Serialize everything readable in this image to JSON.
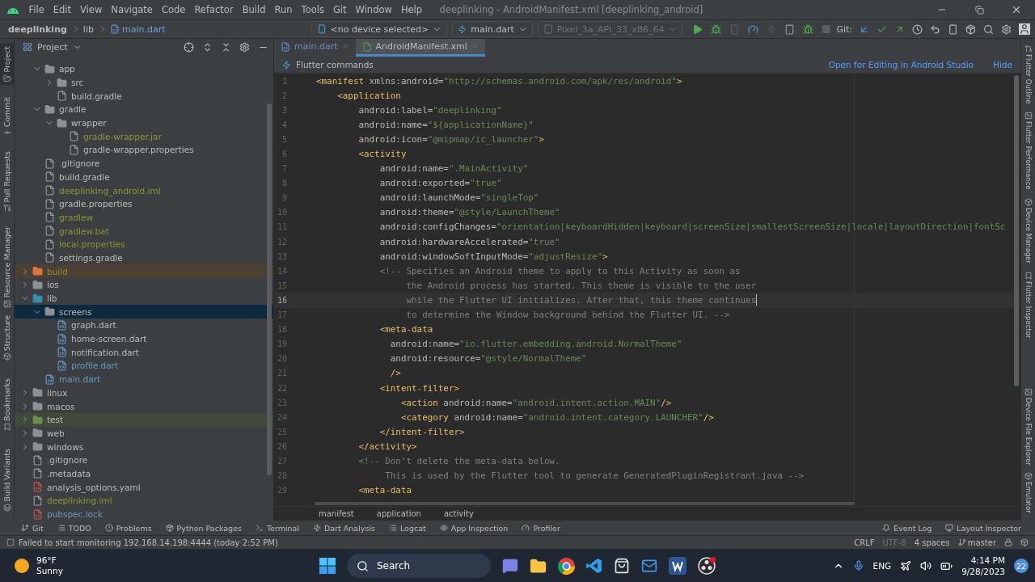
{
  "title_bar": {
    "menus": [
      "File",
      "Edit",
      "View",
      "Navigate",
      "Code",
      "Refactor",
      "Build",
      "Run",
      "Tools",
      "Git",
      "Window",
      "Help"
    ],
    "title": "deeplinking - AndroidManifest.xml [deeplinking_android]"
  },
  "nav_bar": {
    "breadcrumbs": [
      "deeplinking",
      "lib",
      "main.dart"
    ],
    "device": "<no device selected>",
    "run_config": "main.dart",
    "emulator": "Pixel_3a_API_33_x86_64",
    "git_label": "Git:"
  },
  "left_tool_strip": {
    "top": [
      {
        "label": "Project",
        "selected": true
      },
      {
        "label": "Commit",
        "selected": false
      },
      {
        "label": "Pull Requests",
        "selected": false
      },
      {
        "label": "Resource Manager",
        "selected": false
      }
    ],
    "bottom": [
      {
        "label": "Structure",
        "selected": false
      },
      {
        "label": "Bookmarks",
        "selected": false
      },
      {
        "label": "Build Variants",
        "selected": false
      }
    ]
  },
  "project_panel": {
    "title": "Project",
    "tree": [
      {
        "kind": "offscreen",
        "children": [
          {
            "label": "app",
            "kind": "folder",
            "ignored": false,
            "modified": false,
            "selected": false,
            "expanded": true,
            "children": [
              {
                "label": "src",
                "kind": "folder",
                "ignored": false,
                "modified": false,
                "selected": false,
                "expanded": false
              },
              {
                "label": "build.gradle",
                "kind": "file",
                "ignored": false,
                "modified": false,
                "selected": false
              }
            ]
          },
          {
            "label": "gradle",
            "kind": "folder",
            "ignored": false,
            "modified": false,
            "selected": false,
            "expanded": true,
            "children": [
              {
                "label": "wrapper",
                "kind": "folder",
                "ignored": false,
                "modified": false,
                "selected": false,
                "expanded": true,
                "children": [
                  {
                    "label": "gradle-wrapper.jar",
                    "kind": "file",
                    "ignored": true,
                    "modified": false,
                    "selected": false
                  },
                  {
                    "label": "gradle-wrapper.properties",
                    "kind": "file",
                    "ignored": false,
                    "modified": false,
                    "selected": false
                  }
                ]
              }
            ]
          },
          {
            "label": ".gitignore",
            "kind": "file",
            "ignored": false,
            "modified": false,
            "selected": false
          },
          {
            "label": "build.gradle",
            "kind": "file",
            "ignored": false,
            "modified": false,
            "selected": false
          },
          {
            "label": "deeplinking_android.iml",
            "kind": "file",
            "ignored": true,
            "modified": false,
            "selected": false
          },
          {
            "label": "gradle.properties",
            "kind": "file",
            "ignored": false,
            "modified": false,
            "selected": false
          },
          {
            "label": "gradlew",
            "kind": "file",
            "ignored": true,
            "modified": false,
            "selected": false
          },
          {
            "label": "gradlew.bat",
            "kind": "file",
            "ignored": true,
            "modified": false,
            "selected": false
          },
          {
            "label": "local.properties",
            "kind": "file",
            "ignored": true,
            "modified": false,
            "selected": false
          },
          {
            "label": "settings.gradle",
            "kind": "file",
            "ignored": false,
            "modified": false,
            "selected": false
          }
        ]
      },
      {
        "label": "build",
        "kind": "excluded-folder",
        "ignored": true,
        "modified": false,
        "selected": false,
        "expanded": false
      },
      {
        "label": "ios",
        "kind": "folder",
        "ignored": false,
        "modified": false,
        "selected": false,
        "expanded": false
      },
      {
        "label": "lib",
        "kind": "source-folder",
        "ignored": false,
        "modified": false,
        "selected": false,
        "expanded": true,
        "children": [
          {
            "label": "screens",
            "kind": "folder",
            "ignored": false,
            "modified": false,
            "selected": true,
            "expanded": true,
            "children": [
              {
                "label": "graph.dart",
                "kind": "dart-file",
                "ignored": false,
                "modified": false,
                "selected": false
              },
              {
                "label": "home-screen.dart",
                "kind": "dart-file",
                "ignored": false,
                "modified": false,
                "selected": false
              },
              {
                "label": "notification.dart",
                "kind": "dart-file",
                "ignored": false,
                "modified": false,
                "selected": false
              },
              {
                "label": "profile.dart",
                "kind": "dart-file",
                "ignored": false,
                "modified": true,
                "selected": false
              }
            ]
          },
          {
            "label": "main.dart",
            "kind": "dart-file",
            "ignored": false,
            "modified": true,
            "selected": false
          }
        ]
      },
      {
        "label": "linux",
        "kind": "folder",
        "ignored": false,
        "modified": false,
        "selected": false,
        "expanded": false
      },
      {
        "label": "macos",
        "kind": "folder",
        "ignored": false,
        "modified": false,
        "selected": false,
        "expanded": false
      },
      {
        "label": "test",
        "kind": "test-folder",
        "ignored": false,
        "modified": false,
        "selected": false,
        "expanded": false
      },
      {
        "label": "web",
        "kind": "folder",
        "ignored": false,
        "modified": false,
        "selected": false,
        "expanded": false
      },
      {
        "label": "windows",
        "kind": "folder",
        "ignored": false,
        "modified": false,
        "selected": false,
        "expanded": false
      },
      {
        "label": ".gitignore",
        "kind": "file",
        "ignored": false,
        "modified": false,
        "selected": false
      },
      {
        "label": ".metadata",
        "kind": "file",
        "ignored": false,
        "modified": false,
        "selected": false
      },
      {
        "label": "analysis_options.yaml",
        "kind": "yaml-file",
        "ignored": false,
        "modified": false,
        "selected": false
      },
      {
        "label": "deeplinking.iml",
        "kind": "file",
        "ignored": true,
        "modified": false,
        "selected": false
      },
      {
        "label": "pubspec.lock",
        "kind": "yaml-file",
        "ignored": false,
        "modified": true,
        "selected": false
      }
    ]
  },
  "editor": {
    "tabs": [
      {
        "label": "main.dart",
        "kind": "dart",
        "selected": false
      },
      {
        "label": "AndroidManifest.xml",
        "kind": "xml",
        "selected": true
      }
    ],
    "banner": {
      "title": "Flutter commands",
      "action": "Open for Editing in Android Studio",
      "dismiss": "Hide"
    },
    "lines": [
      {
        "n": "1",
        "current": false,
        "tokens": [
          {
            "kind": "tag",
            "text": "<manifest"
          },
          {
            "kind": "attr",
            "text": " xmlns:android="
          },
          {
            "kind": "value",
            "text": "\"http://schemas.android.com/apk/res/android\""
          },
          {
            "kind": "tag",
            "text": ">"
          }
        ]
      },
      {
        "n": "2",
        "current": false,
        "tokens": [
          {
            "kind": "tag",
            "text": "    <application"
          }
        ]
      },
      {
        "n": "3",
        "current": false,
        "tokens": [
          {
            "kind": "attr",
            "text": "        android:label="
          },
          {
            "kind": "value",
            "text": "\"deeplinking\""
          }
        ]
      },
      {
        "n": "4",
        "current": false,
        "tokens": [
          {
            "kind": "attr",
            "text": "        android:name="
          },
          {
            "kind": "value",
            "text": "\"${applicationName}\""
          }
        ]
      },
      {
        "n": "5",
        "current": false,
        "tokens": [
          {
            "kind": "attr",
            "text": "        android:icon="
          },
          {
            "kind": "value",
            "text": "\"@mipmap/ic_launcher\""
          },
          {
            "kind": "tag",
            "text": ">"
          }
        ]
      },
      {
        "n": "6",
        "current": false,
        "tokens": [
          {
            "kind": "tag",
            "text": "        <activity"
          }
        ]
      },
      {
        "n": "7",
        "current": false,
        "tokens": [
          {
            "kind": "attr",
            "text": "            android:name="
          },
          {
            "kind": "value",
            "text": "\".MainActivity\""
          }
        ]
      },
      {
        "n": "8",
        "current": false,
        "tokens": [
          {
            "kind": "attr",
            "text": "            android:exported="
          },
          {
            "kind": "value",
            "text": "\"true\""
          }
        ]
      },
      {
        "n": "9",
        "current": false,
        "tokens": [
          {
            "kind": "attr",
            "text": "            android:launchMode="
          },
          {
            "kind": "value",
            "text": "\"singleTop\""
          }
        ]
      },
      {
        "n": "10",
        "current": false,
        "tokens": [
          {
            "kind": "attr",
            "text": "            android:theme="
          },
          {
            "kind": "value",
            "text": "\"@style/LaunchTheme\""
          }
        ]
      },
      {
        "n": "11",
        "current": false,
        "tokens": [
          {
            "kind": "attr",
            "text": "            android:configChanges="
          },
          {
            "kind": "value",
            "text": "\"orientation|keyboardHidden|keyboard|screenSize|smallestScreenSize|locale|layoutDirection|fontSc"
          }
        ]
      },
      {
        "n": "12",
        "current": false,
        "tokens": [
          {
            "kind": "attr",
            "text": "            android:hardwareAccelerated="
          },
          {
            "kind": "value",
            "text": "\"true\""
          }
        ]
      },
      {
        "n": "13",
        "current": false,
        "tokens": [
          {
            "kind": "attr",
            "text": "            android:windowSoftInputMode="
          },
          {
            "kind": "value",
            "text": "\"adjustResize\""
          },
          {
            "kind": "tag",
            "text": ">"
          }
        ]
      },
      {
        "n": "14",
        "current": false,
        "tokens": [
          {
            "kind": "comment",
            "text": "            <!-- Specifies an Android theme to apply to this Activity as soon as"
          }
        ]
      },
      {
        "n": "15",
        "current": false,
        "tokens": [
          {
            "kind": "comment",
            "text": "                 the Android process has started. This theme is visible to the user"
          }
        ]
      },
      {
        "n": "16",
        "current": true,
        "tokens": [
          {
            "kind": "comment",
            "text": "                 while the Flutter UI initializes. After that, this theme continues"
          }
        ]
      },
      {
        "n": "17",
        "current": false,
        "tokens": [
          {
            "kind": "comment",
            "text": "                 to determine the Window background behind the Flutter UI. -->"
          }
        ]
      },
      {
        "n": "18",
        "current": false,
        "tokens": [
          {
            "kind": "tag",
            "text": "            <meta-data"
          }
        ]
      },
      {
        "n": "19",
        "current": false,
        "tokens": [
          {
            "kind": "attr",
            "text": "              android:name="
          },
          {
            "kind": "value",
            "text": "\"io.flutter.embedding.android.NormalTheme\""
          }
        ]
      },
      {
        "n": "20",
        "current": false,
        "tokens": [
          {
            "kind": "attr",
            "text": "              android:resource="
          },
          {
            "kind": "value",
            "text": "\"@style/NormalTheme\""
          }
        ]
      },
      {
        "n": "21",
        "current": false,
        "tokens": [
          {
            "kind": "tag",
            "text": "              />"
          }
        ]
      },
      {
        "n": "22",
        "current": false,
        "tokens": [
          {
            "kind": "tag",
            "text": "            <intent-filter>"
          }
        ]
      },
      {
        "n": "23",
        "current": false,
        "tokens": [
          {
            "kind": "tag",
            "text": "                <action"
          },
          {
            "kind": "attr",
            "text": " android:name="
          },
          {
            "kind": "value",
            "text": "\"android.intent.action.MAIN\""
          },
          {
            "kind": "tag",
            "text": "/>"
          }
        ]
      },
      {
        "n": "24",
        "current": false,
        "tokens": [
          {
            "kind": "tag",
            "text": "                <category"
          },
          {
            "kind": "attr",
            "text": " android:name="
          },
          {
            "kind": "value",
            "text": "\"android.intent.category.LAUNCHER\""
          },
          {
            "kind": "tag",
            "text": "/>"
          }
        ]
      },
      {
        "n": "25",
        "current": false,
        "tokens": [
          {
            "kind": "tag",
            "text": "            </intent-filter>"
          }
        ]
      },
      {
        "n": "26",
        "current": false,
        "tokens": [
          {
            "kind": "tag",
            "text": "        </activity>"
          }
        ]
      },
      {
        "n": "27",
        "current": false,
        "tokens": [
          {
            "kind": "comment",
            "text": "        <!-- Don't delete the meta-data below."
          }
        ]
      },
      {
        "n": "28",
        "current": false,
        "tokens": [
          {
            "kind": "comment",
            "text": "             This is used by the Flutter tool to generate GeneratedPluginRegistrant.java -->"
          }
        ]
      },
      {
        "n": "29",
        "current": false,
        "tokens": [
          {
            "kind": "tag",
            "text": "        <meta-data"
          }
        ]
      }
    ],
    "breadcrumbs": [
      "manifest",
      "application",
      "activity"
    ]
  },
  "right_tool_strip": {
    "top": [
      "Flutter Outline",
      "Flutter Performance",
      "Device Manager",
      "Flutter Inspector"
    ],
    "bottom": [
      "Device File Explorer",
      "Emulator"
    ]
  },
  "bottom_tool_bar": {
    "left": [
      {
        "label": "Git",
        "kind": "git"
      },
      {
        "label": "TODO",
        "kind": "todo"
      },
      {
        "label": "Problems",
        "kind": "problems"
      },
      {
        "label": "Python Packages",
        "kind": "packages"
      },
      {
        "label": "Terminal",
        "kind": "terminal"
      },
      {
        "label": "Dart Analysis",
        "kind": "analysis"
      },
      {
        "label": "Logcat",
        "kind": "logcat"
      },
      {
        "label": "App Inspection",
        "kind": "inspection"
      },
      {
        "label": "Profiler",
        "kind": "profiler"
      }
    ],
    "right": [
      {
        "label": "Event Log",
        "kind": "log"
      },
      {
        "label": "Layout Inspector",
        "kind": "layout"
      }
    ]
  },
  "status_bar": {
    "message": "Failed to start monitoring 192.168.14.198:4444 (today 2:52 PM)",
    "items": [
      {
        "text": "CRLF",
        "disabled": false
      },
      {
        "text": "UTF-8",
        "disabled": true
      },
      {
        "text": "4 spaces",
        "disabled": false
      }
    ],
    "branch": "master"
  },
  "taskbar": {
    "temperature": "96°F",
    "condition": "Sunny",
    "search": "Search",
    "language": "ENG",
    "time": "4:14 PM",
    "date": "9/28/2023",
    "notifications": "22"
  }
}
